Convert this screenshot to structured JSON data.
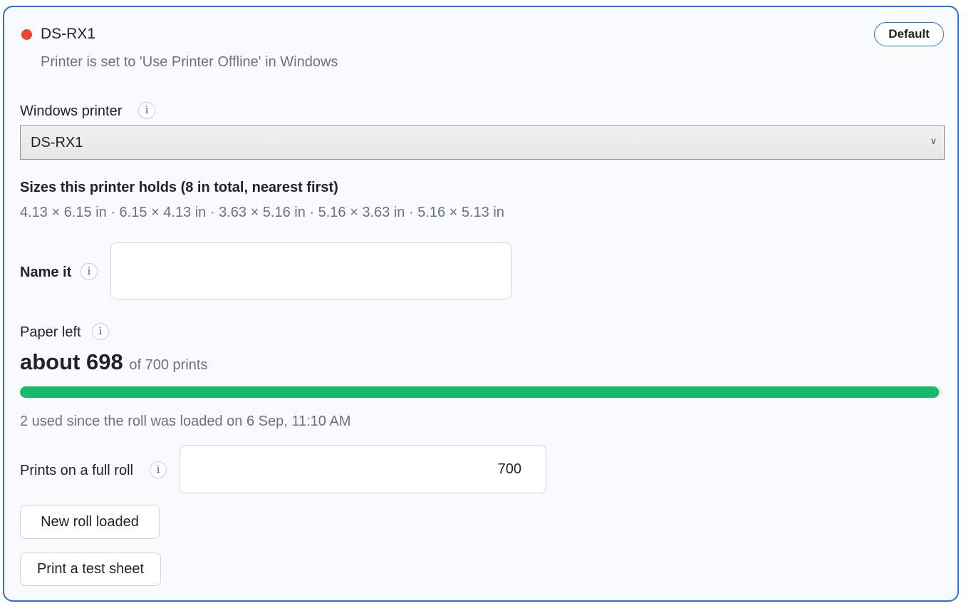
{
  "printer": {
    "name": "DS-RX1",
    "status_color": "#ef4432",
    "status_text": "Printer is set to 'Use Printer Offline' in Windows",
    "default_badge": "Default"
  },
  "windows_printer": {
    "label": "Windows printer",
    "info_icon": "i",
    "selected": "DS-RX1"
  },
  "sizes": {
    "heading": "Sizes this printer holds (8 in total, nearest first)",
    "list": "4.13 × 6.15 in · 6.15 × 4.13 in · 3.63 × 5.16 in · 5.16 × 3.63 in · 5.16 × 5.13 in"
  },
  "name_it": {
    "label": "Name it",
    "info_icon": "i",
    "value": ""
  },
  "paper": {
    "label": "Paper left",
    "info_icon": "i",
    "count_text": "about 698",
    "of_text": "of 700 prints",
    "remaining": 698,
    "total": 700,
    "progress_color": "#17b96b",
    "used_text": "2 used since the roll was loaded on 6 Sep, 11:10 AM"
  },
  "full_roll": {
    "label": "Prints on a full roll",
    "info_icon": "i",
    "value": "700"
  },
  "buttons": {
    "new_roll": "New roll loaded",
    "test_sheet": "Print a test sheet"
  },
  "colors": {
    "accent": "#2f6fd6",
    "muted_text": "#6b7280"
  }
}
